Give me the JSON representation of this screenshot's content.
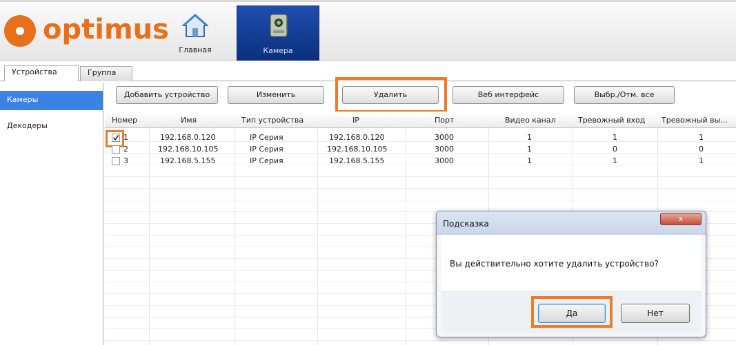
{
  "app": {
    "logo_text": "optimus",
    "accent_color": "#e8701a"
  },
  "nav": {
    "home": {
      "label": "Главная",
      "icon": "house-icon"
    },
    "camera": {
      "label": "Камера",
      "icon": "camera-device-icon"
    }
  },
  "tabs": {
    "devices": "Устройства",
    "group": "Группа"
  },
  "sidebar": {
    "cameras": "Камеры",
    "decoders": "Декодеры"
  },
  "toolbar": {
    "add": "Добавить устройство",
    "edit": "Изменить",
    "delete": "Удалить",
    "web": "Веб интерфейс",
    "select_all": "Выбр./Отм. все"
  },
  "table": {
    "headers": {
      "num": "Номер",
      "name": "Имя",
      "type": "Тип устройства",
      "ip": "IP",
      "port": "Порт",
      "video": "Видео канал",
      "alarm_in": "Тревожный вход",
      "alarm_out": "Тревожный вы..."
    },
    "rows": [
      {
        "checked": true,
        "num": "1",
        "name": "192.168.0.120",
        "type": "IP Серия",
        "ip": "192.168.0.120",
        "port": "3000",
        "video": "1",
        "alarm_in": "1",
        "alarm_out": "1"
      },
      {
        "checked": false,
        "num": "2",
        "name": "192.168.10.105",
        "type": "IP Серия",
        "ip": "192.168.10.105",
        "port": "3000",
        "video": "1",
        "alarm_in": "0",
        "alarm_out": "0"
      },
      {
        "checked": false,
        "num": "3",
        "name": "192.168.5.155",
        "type": "IP Серия",
        "ip": "192.168.5.155",
        "port": "3000",
        "video": "1",
        "alarm_in": "1",
        "alarm_out": "1"
      }
    ]
  },
  "dialog": {
    "title": "Подсказка",
    "message": "Вы действительно хотите удалить устройство?",
    "yes": "Да",
    "no": "Нет",
    "close": "x"
  }
}
